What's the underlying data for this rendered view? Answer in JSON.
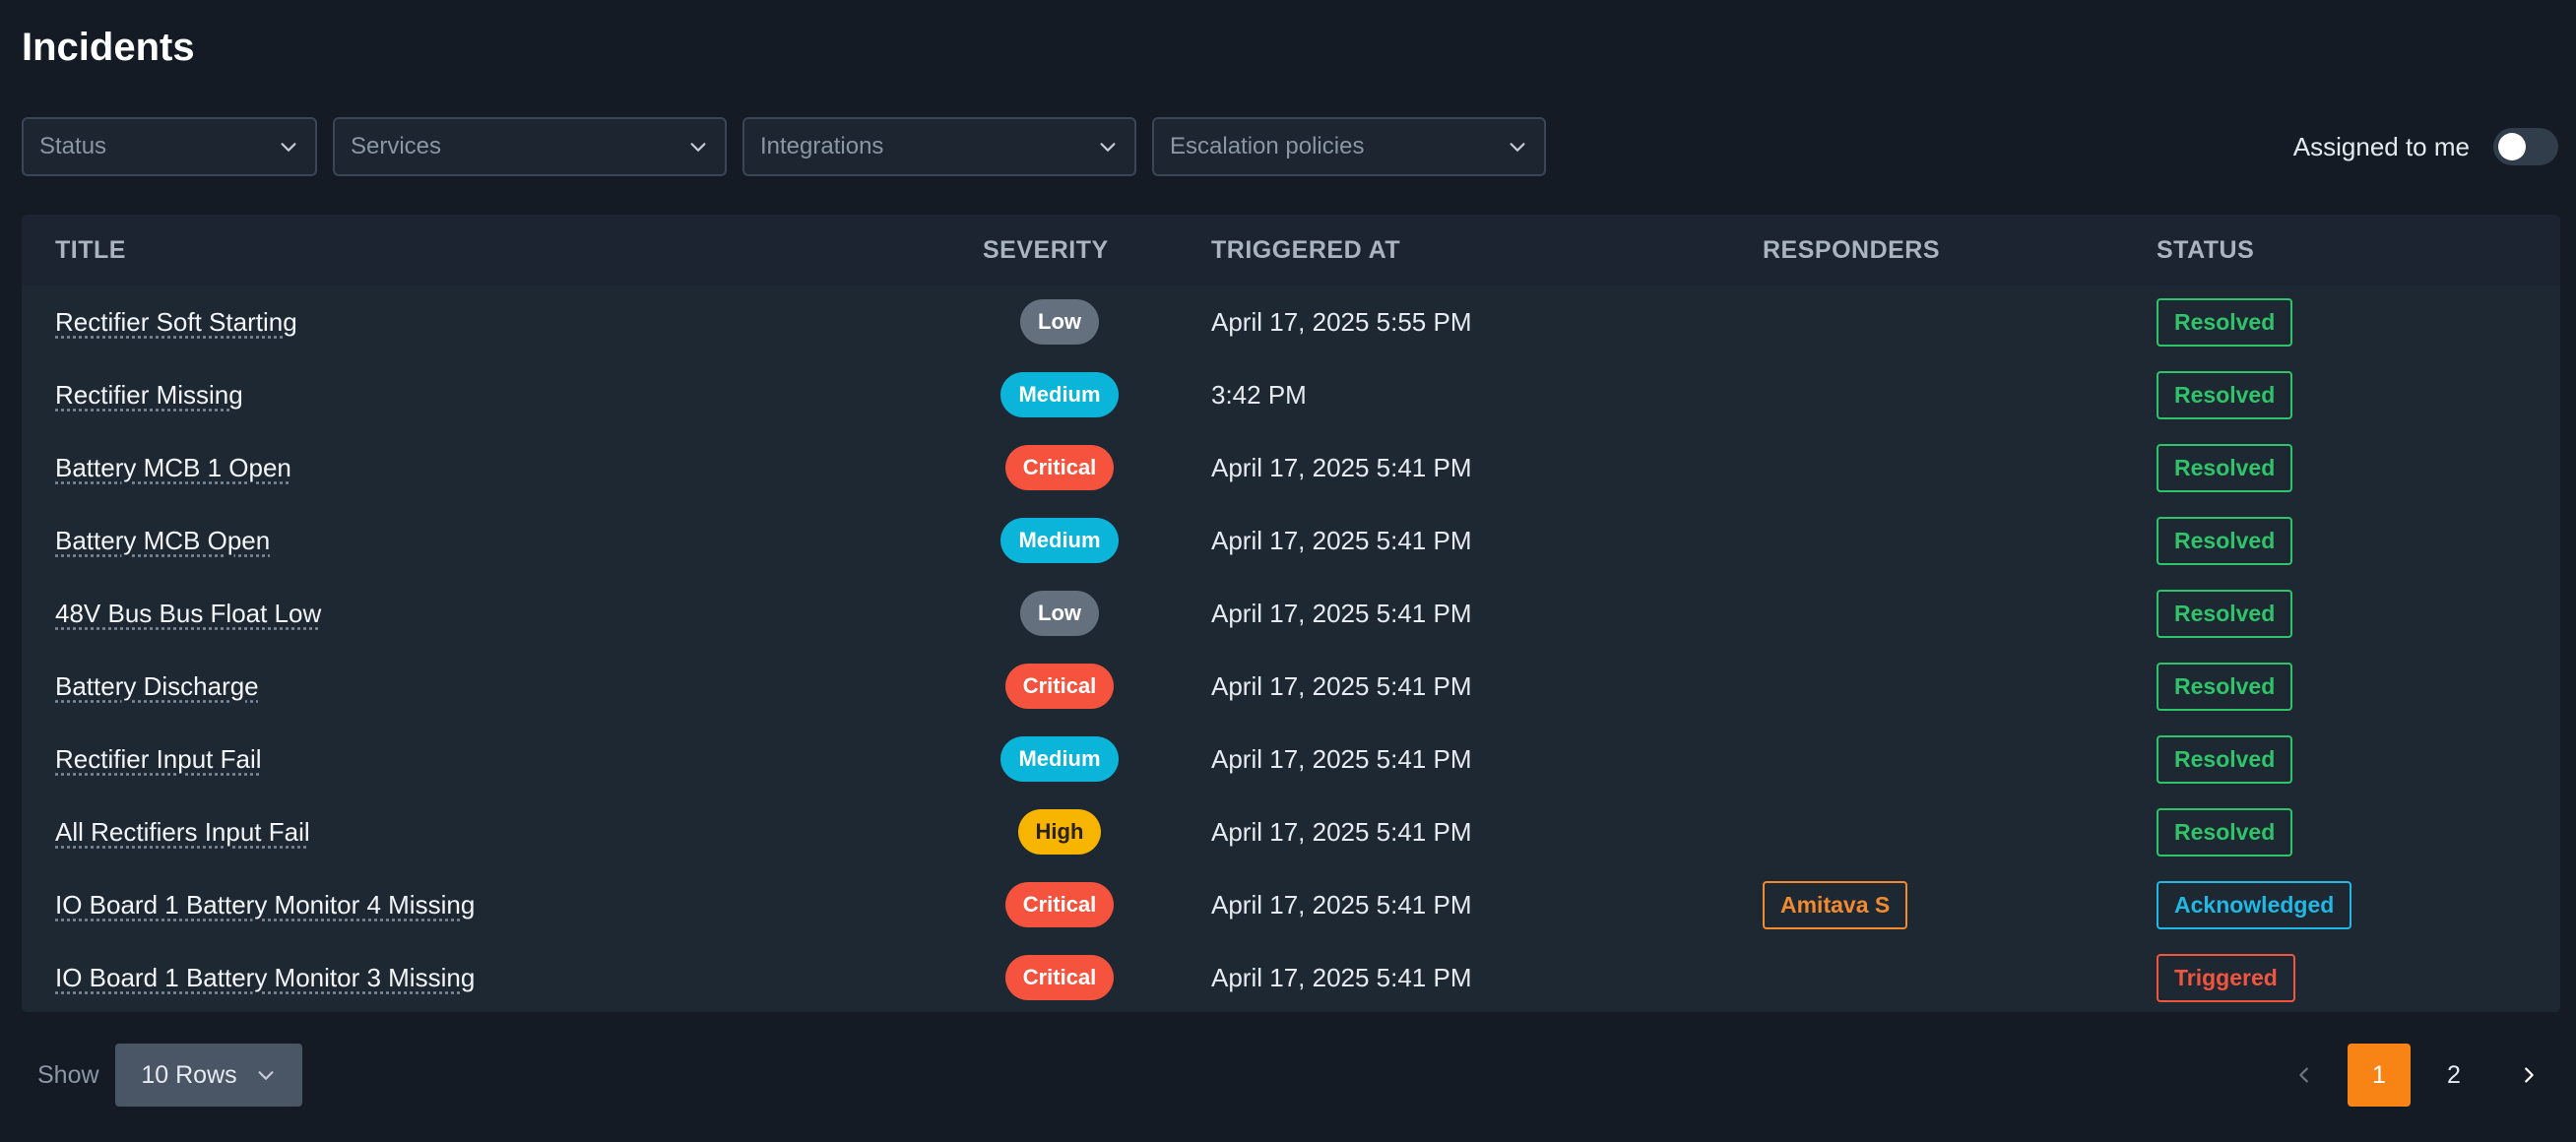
{
  "page": {
    "title": "Incidents"
  },
  "filters": {
    "status": "Status",
    "services": "Services",
    "integrations": "Integrations",
    "escalation": "Escalation policies",
    "assigned_label": "Assigned to me",
    "assigned_on": false
  },
  "table": {
    "headers": [
      "TITLE",
      "SEVERITY",
      "TRIGGERED AT",
      "RESPONDERS",
      "STATUS"
    ],
    "rows": [
      {
        "title": "Rectifier Soft Starting",
        "severity": "Low",
        "triggered": "April 17, 2025 5:55 PM",
        "responder": "",
        "status": "Resolved"
      },
      {
        "title": "Rectifier Missing",
        "severity": "Medium",
        "triggered": "3:42 PM",
        "responder": "",
        "status": "Resolved"
      },
      {
        "title": "Battery MCB 1 Open",
        "severity": "Critical",
        "triggered": "April 17, 2025 5:41 PM",
        "responder": "",
        "status": "Resolved"
      },
      {
        "title": "Battery MCB Open",
        "severity": "Medium",
        "triggered": "April 17, 2025 5:41 PM",
        "responder": "",
        "status": "Resolved"
      },
      {
        "title": "48V Bus Bus Float Low",
        "severity": "Low",
        "triggered": "April 17, 2025 5:41 PM",
        "responder": "",
        "status": "Resolved"
      },
      {
        "title": "Battery Discharge",
        "severity": "Critical",
        "triggered": "April 17, 2025 5:41 PM",
        "responder": "",
        "status": "Resolved"
      },
      {
        "title": "Rectifier Input Fail",
        "severity": "Medium",
        "triggered": "April 17, 2025 5:41 PM",
        "responder": "",
        "status": "Resolved"
      },
      {
        "title": "All Rectifiers Input Fail",
        "severity": "High",
        "triggered": "April 17, 2025 5:41 PM",
        "responder": "",
        "status": "Resolved"
      },
      {
        "title": "IO Board 1 Battery Monitor 4 Missing",
        "severity": "Critical",
        "triggered": "April 17, 2025 5:41 PM",
        "responder": "Amitava S",
        "status": "Acknowledged"
      },
      {
        "title": "IO Board 1 Battery Monitor 3 Missing",
        "severity": "Critical",
        "triggered": "April 17, 2025 5:41 PM",
        "responder": "",
        "status": "Triggered"
      }
    ]
  },
  "footer": {
    "show_label": "Show",
    "rows_select": "10 Rows",
    "pages": [
      "1",
      "2"
    ],
    "current_page": "1"
  },
  "colors": {
    "background": "#141b24",
    "accent": "#f98416",
    "low": "#64707e",
    "medium": "#0bb4d9",
    "critical": "#f5533d",
    "high": "#f7b500",
    "resolved": "#2fc46a",
    "acknowledged": "#21b8e3",
    "triggered": "#f2553e"
  },
  "icons": {
    "dropdown": "chevron-down-icon",
    "prev": "chevron-left-icon",
    "next": "chevron-right-icon"
  }
}
